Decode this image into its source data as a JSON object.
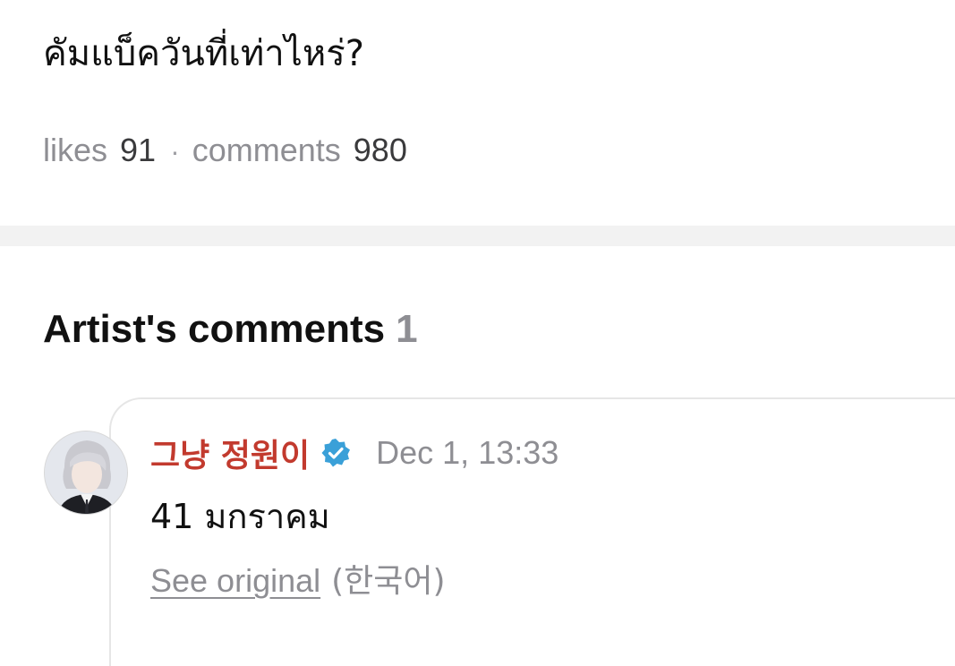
{
  "post": {
    "question": "คัมแบ็ควันที่เท่าไหร่?",
    "likes_label": "likes",
    "likes_count": "91",
    "separator": "·",
    "comments_label": "comments",
    "comments_count": "980"
  },
  "artist_comments": {
    "title": "Artist's comments",
    "count": "1",
    "items": [
      {
        "author": "그냥 정원이",
        "verified": true,
        "time": "Dec 1, 13:33",
        "text": "41 มกราคม",
        "see_original_label": "See original",
        "original_language": "(한국어)"
      }
    ]
  },
  "colors": {
    "author_name": "#c23a2e",
    "verified_badge": "#3aa0d8",
    "muted_text": "#8e8e93",
    "divider_band": "#f2f2f2"
  },
  "icons": {
    "verified": "verified-badge-icon"
  }
}
